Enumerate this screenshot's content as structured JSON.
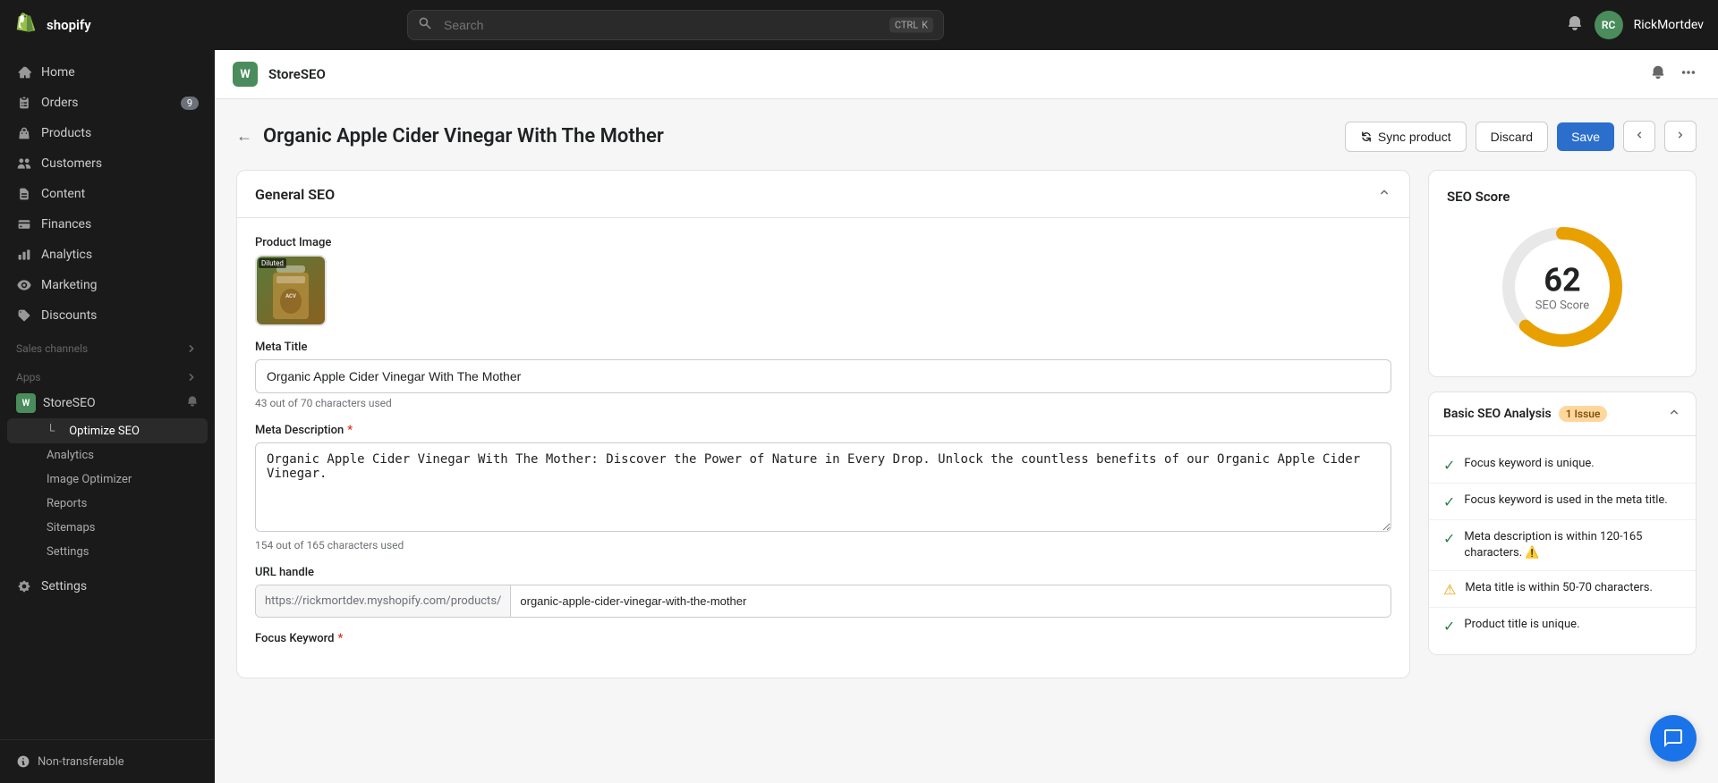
{
  "topbar": {
    "logo_text": "shopify",
    "search_placeholder": "Search",
    "search_shortcut": [
      "CTRL",
      "K"
    ],
    "bell_icon": "bell",
    "username": "RickMortdev",
    "avatar_initials": "RC"
  },
  "sidebar": {
    "nav_items": [
      {
        "id": "home",
        "label": "Home",
        "icon": "home"
      },
      {
        "id": "orders",
        "label": "Orders",
        "icon": "orders",
        "badge": "9"
      },
      {
        "id": "products",
        "label": "Products",
        "icon": "products"
      },
      {
        "id": "customers",
        "label": "Customers",
        "icon": "customers"
      },
      {
        "id": "content",
        "label": "Content",
        "icon": "content"
      },
      {
        "id": "finances",
        "label": "Finances",
        "icon": "finances"
      },
      {
        "id": "analytics",
        "label": "Analytics",
        "icon": "analytics"
      },
      {
        "id": "marketing",
        "label": "Marketing",
        "icon": "marketing"
      },
      {
        "id": "discounts",
        "label": "Discounts",
        "icon": "discounts"
      }
    ],
    "sales_channels_label": "Sales channels",
    "apps_label": "Apps",
    "app_items": [
      {
        "id": "storeseo",
        "label": "StoreSEO",
        "icon": "W",
        "color": "#4a8c5c"
      }
    ],
    "sub_items": [
      {
        "id": "optimize-seo",
        "label": "Optimize SEO",
        "active": true
      },
      {
        "id": "analytics-sub",
        "label": "Analytics"
      },
      {
        "id": "image-optimizer",
        "label": "Image Optimizer"
      },
      {
        "id": "reports-sub",
        "label": "Reports"
      },
      {
        "id": "sitemaps",
        "label": "Sitemaps"
      },
      {
        "id": "settings-sub",
        "label": "Settings"
      }
    ],
    "settings_label": "Settings",
    "non_transferable_label": "Non-transferable"
  },
  "app_header": {
    "app_icon": "W",
    "app_name": "StoreSEO",
    "bell_icon": "bell",
    "more_icon": "more"
  },
  "page": {
    "back_icon": "arrow-left",
    "title": "Organic Apple Cider Vinegar With The Mother",
    "actions": {
      "sync_label": "Sync product",
      "discard_label": "Discard",
      "save_label": "Save",
      "prev_icon": "chevron-left",
      "next_icon": "chevron-right"
    }
  },
  "general_seo": {
    "section_title": "General SEO",
    "product_image_label": "Product Image",
    "product_image_badge": "Diluted",
    "meta_title_label": "Meta Title",
    "meta_title_value": "Organic Apple Cider Vinegar With The Mother",
    "meta_title_hint": "43 out of 70 characters used",
    "meta_description_label": "Meta Description",
    "meta_description_required": true,
    "meta_description_value": "Organic Apple Cider Vinegar With The Mother: Discover the Power of Nature in Every Drop. Unlock the countless benefits of our Organic Apple Cider Vinegar.",
    "meta_description_hint": "154 out of 165 characters used",
    "url_handle_label": "URL handle",
    "url_prefix": "https://rickmortdev.myshopify.com/products/",
    "url_value": "organic-apple-cider-vinegar-with-the-mother",
    "focus_keyword_label": "Focus Keyword",
    "focus_keyword_required": true
  },
  "seo_score": {
    "title": "SEO Score",
    "score": "62",
    "label": "SEO Score",
    "donut_color": "#e8a000",
    "donut_bg": "#e8e8e8",
    "percentage": 62
  },
  "basic_seo": {
    "title": "Basic SEO Analysis",
    "issue_badge": "1 Issue",
    "items": [
      {
        "status": "ok",
        "text": "Focus keyword is unique."
      },
      {
        "status": "ok",
        "text": "Focus keyword is used in the meta title."
      },
      {
        "status": "ok",
        "text": "Meta description is within 120-165 characters. ⚠️"
      },
      {
        "status": "warn",
        "text": "Meta title is within 50-70 characters."
      },
      {
        "status": "ok",
        "text": "Product title is unique."
      }
    ]
  }
}
